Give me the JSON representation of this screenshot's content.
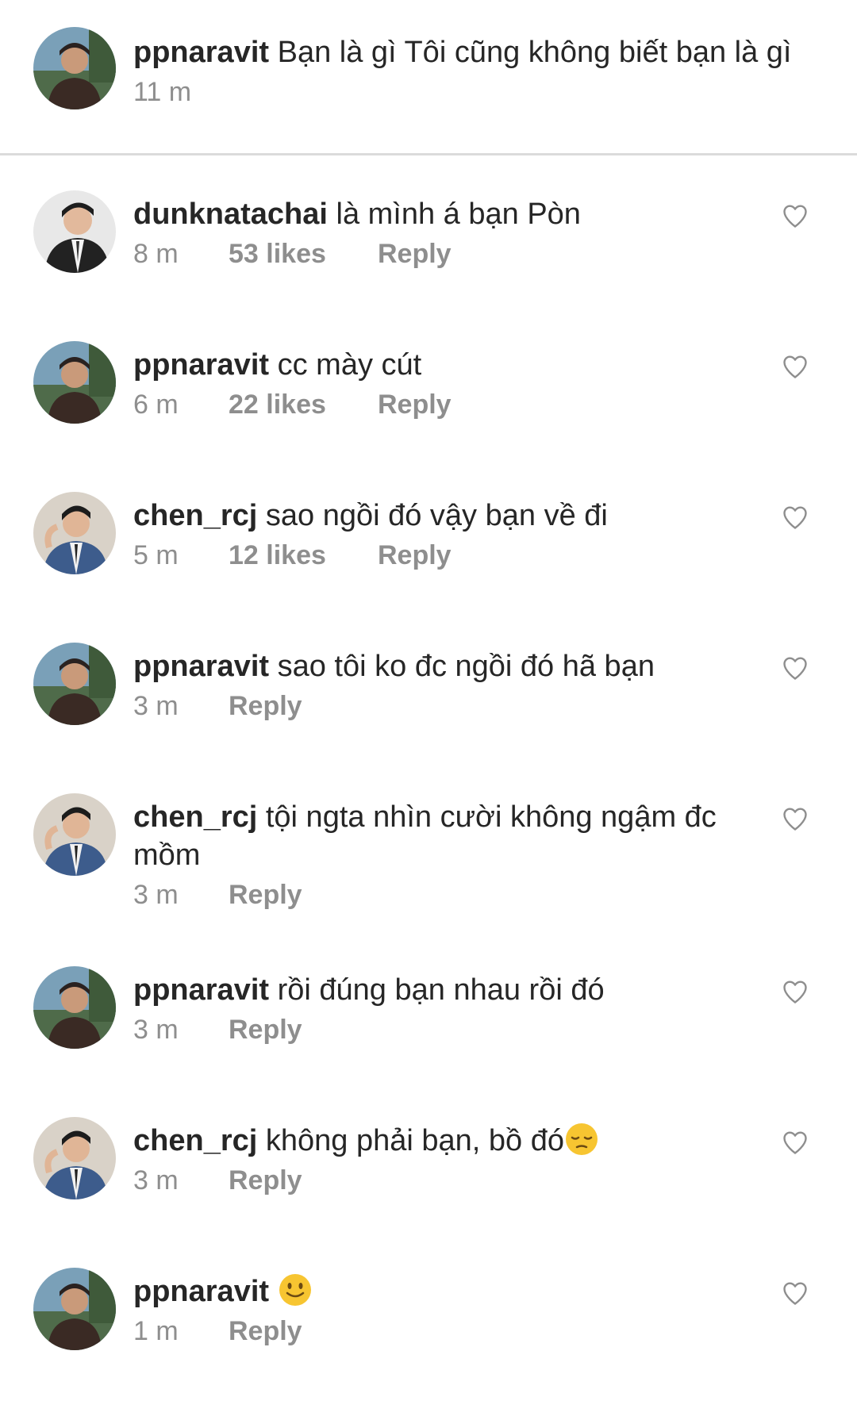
{
  "caption": {
    "username": "ppnaravit",
    "text": " Bạn là gì Tôi cũng không biết bạn là gì",
    "time": "11 m"
  },
  "comments": [
    {
      "username": "dunknatachai",
      "text": " là mình á bạn Pòn",
      "time": "8 m",
      "likes": "53 likes",
      "reply": "Reply",
      "avatar": "avatar-dunk"
    },
    {
      "username": "ppnaravit",
      "text": " cc mày cút",
      "time": "6 m",
      "likes": "22 likes",
      "reply": "Reply",
      "avatar": "avatar-pp"
    },
    {
      "username": "chen_rcj",
      "text": " sao ngồi đó vậy bạn về đi",
      "time": "5 m",
      "likes": "12 likes",
      "reply": "Reply",
      "avatar": "avatar-chen"
    },
    {
      "username": "ppnaravit",
      "text": " sao tôi ko đc ngồi đó hã bạn",
      "time": "3 m",
      "likes": "",
      "reply": "Reply",
      "avatar": "avatar-pp"
    },
    {
      "username": "chen_rcj",
      "text": " tội ngta nhìn cười không ngậm đc mồm",
      "time": "3 m",
      "likes": "",
      "reply": "Reply",
      "avatar": "avatar-chen"
    },
    {
      "username": "ppnaravit",
      "text": " rồi đúng bạn nhau rồi đó",
      "time": "3 m",
      "likes": "",
      "reply": "Reply",
      "avatar": "avatar-pp"
    },
    {
      "username": "chen_rcj",
      "text": " không phải bạn, bồ đó",
      "time": "3 m",
      "likes": "",
      "reply": "Reply",
      "avatar": "avatar-chen",
      "emoji": "pensive-emoji"
    },
    {
      "username": "ppnaravit",
      "text": " ",
      "time": "1 m",
      "likes": "",
      "reply": "Reply",
      "avatar": "avatar-pp",
      "emoji": "smile-emoji"
    }
  ],
  "icons": {
    "heart": "heart-outline-icon"
  },
  "colors": {
    "text": "#262626",
    "meta": "#8e8e8e",
    "divider": "#dbdbdb",
    "emoji": "#f7c531"
  }
}
